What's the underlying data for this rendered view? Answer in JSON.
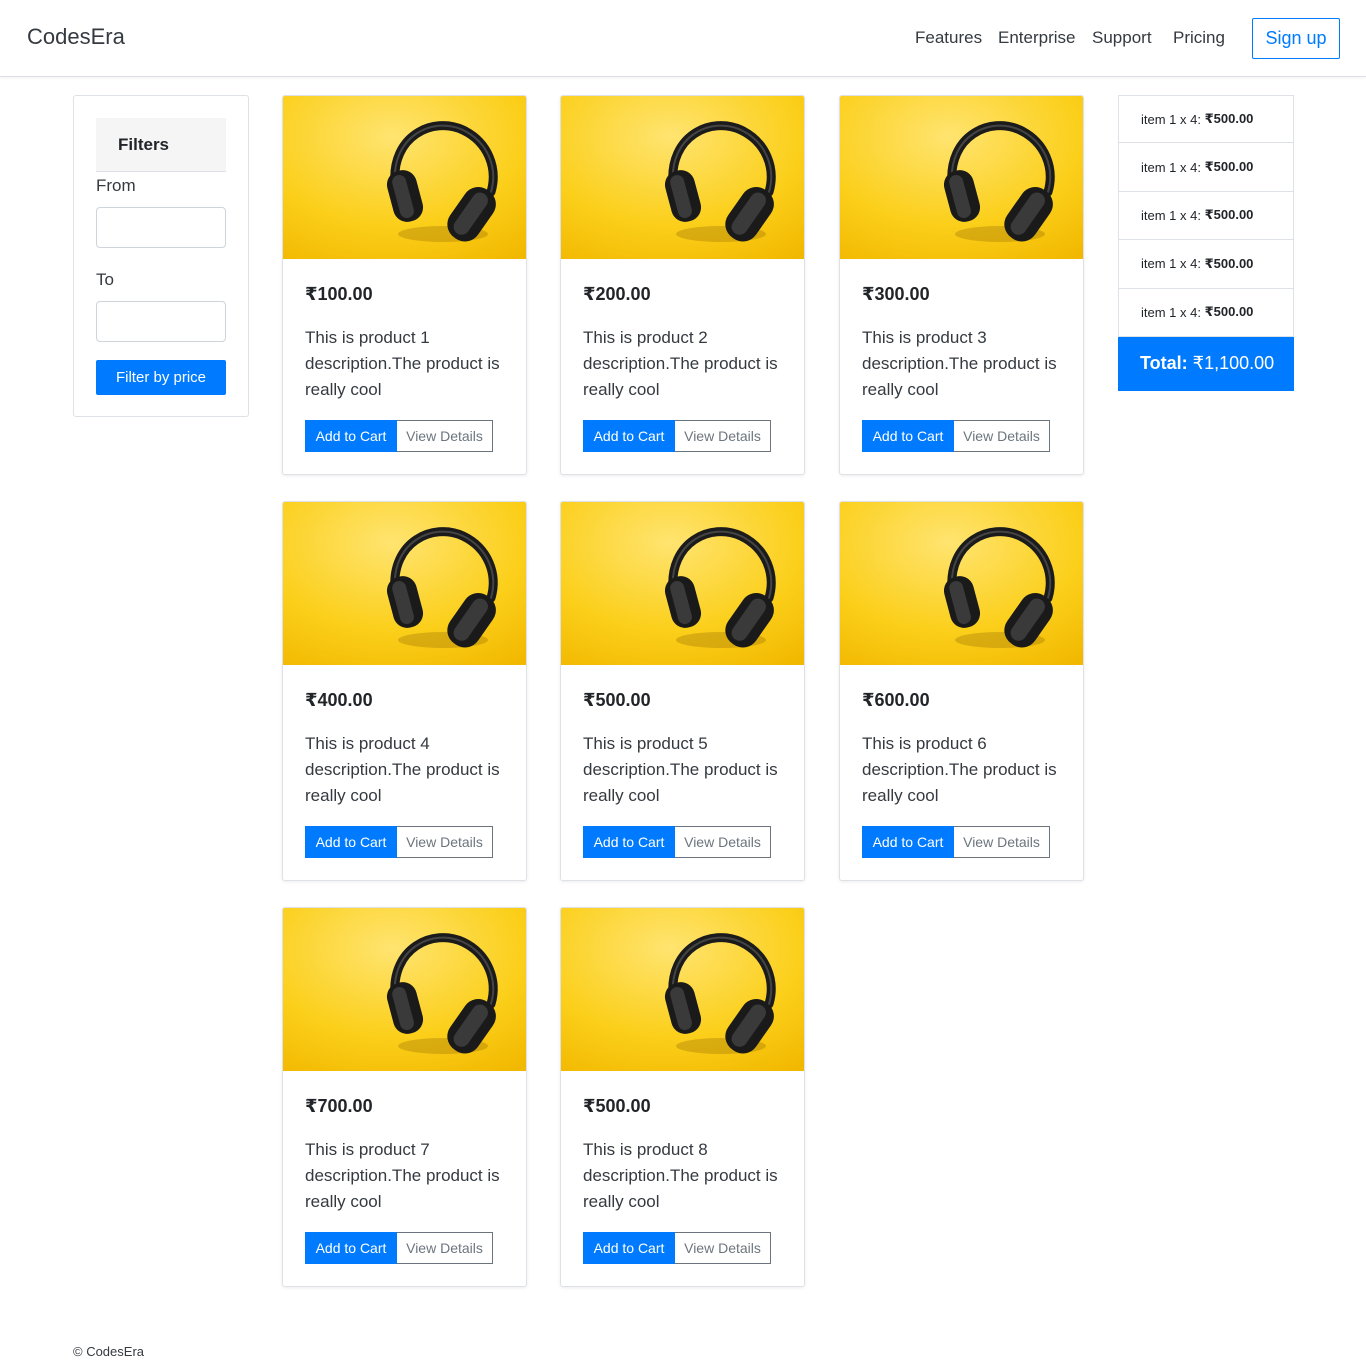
{
  "header": {
    "brand": "CodesEra",
    "nav": [
      "Features",
      "Enterprise",
      "Support",
      "Pricing"
    ],
    "signup": "Sign up"
  },
  "filters": {
    "title": "Filters",
    "from_label": "From",
    "to_label": "To",
    "from_value": "",
    "to_value": "",
    "button": "Filter by price"
  },
  "products": [
    {
      "price": "₹100.00",
      "description": "This is product 1 description.The product is really cool",
      "add": "Add to Cart",
      "view": "View Details"
    },
    {
      "price": "₹200.00",
      "description": "This is product 2 description.The product is really cool",
      "add": "Add to Cart",
      "view": "View Details"
    },
    {
      "price": "₹300.00",
      "description": "This is product 3 description.The product is really cool",
      "add": "Add to Cart",
      "view": "View Details"
    },
    {
      "price": "₹400.00",
      "description": "This is product 4 description.The product is really cool",
      "add": "Add to Cart",
      "view": "View Details"
    },
    {
      "price": "₹500.00",
      "description": "This is product 5 description.The product is really cool",
      "add": "Add to Cart",
      "view": "View Details"
    },
    {
      "price": "₹600.00",
      "description": "This is product 6 description.The product is really cool",
      "add": "Add to Cart",
      "view": "View Details"
    },
    {
      "price": "₹700.00",
      "description": "This is product 7 description.The product is really cool",
      "add": "Add to Cart",
      "view": "View Details"
    },
    {
      "price": "₹500.00",
      "description": "This is product 8 description.The product is really cool",
      "add": "Add to Cart",
      "view": "View Details"
    }
  ],
  "cart": {
    "items": [
      {
        "label": "item 1 x 4:",
        "amount": "₹500.00"
      },
      {
        "label": "item 1 x 4:",
        "amount": "₹500.00"
      },
      {
        "label": "item 1 x 4:",
        "amount": "₹500.00"
      },
      {
        "label": "item 1 x 4:",
        "amount": "₹500.00"
      },
      {
        "label": "item 1 x 4:",
        "amount": "₹500.00"
      }
    ],
    "total_label": "Total:",
    "total_value": "₹1,100.00"
  },
  "footer": "© CodesEra",
  "colors": {
    "primary": "#007bff",
    "image_bg": "#f7c300"
  },
  "product_image_icon": "headphones-icon"
}
